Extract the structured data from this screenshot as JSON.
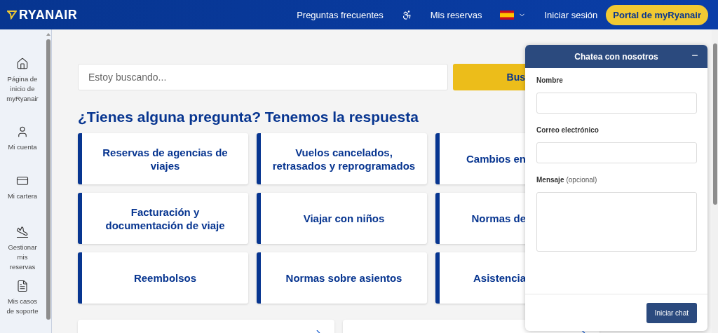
{
  "header": {
    "logo": "RYANAIR",
    "nav": [
      {
        "kind": "link",
        "label": "Preguntas frecuentes"
      },
      {
        "kind": "accessibility"
      },
      {
        "kind": "link",
        "label": "Mis reservas"
      },
      {
        "kind": "language"
      },
      {
        "kind": "link",
        "label": "Iniciar sesión"
      },
      {
        "kind": "pill",
        "label": "Portal de myRyanair"
      }
    ]
  },
  "sidebar": {
    "items": [
      {
        "kind": "home",
        "label": "Página de inicio de myRyanair"
      },
      {
        "kind": "account",
        "label": "Mi cuenta"
      },
      {
        "kind": "wallet",
        "label": "Mi cartera"
      },
      {
        "kind": "bookings",
        "label": "Gestionar mis reservas"
      },
      {
        "kind": "support",
        "label": "Mis casos de soporte"
      }
    ]
  },
  "search": {
    "placeholder": "Estoy buscando...",
    "button": "Bus"
  },
  "heading": "¿Tienes alguna pregunta? Tenemos la respuesta",
  "topics": [
    {
      "label": "Reservas de agencias de viajes"
    },
    {
      "label": "Vuelos cancelados, retrasados y reprogramados"
    },
    {
      "label": "Cambios en"
    },
    {
      "label": "Facturación y documentación de viaje"
    },
    {
      "label": "Viajar con niños"
    },
    {
      "label": "Normas de"
    },
    {
      "label": "Reembolsos"
    },
    {
      "label": "Normas sobre asientos"
    },
    {
      "label": "Asistencia"
    }
  ],
  "chat": {
    "title": "Chatea con nosotros",
    "fields": [
      {
        "kind": "input",
        "label": "Nombre"
      },
      {
        "kind": "input",
        "label": "Correo electrónico"
      },
      {
        "kind": "textarea",
        "label": "Mensaje",
        "hint": "(opcional)"
      }
    ],
    "submit": "Iniciar chat"
  }
}
